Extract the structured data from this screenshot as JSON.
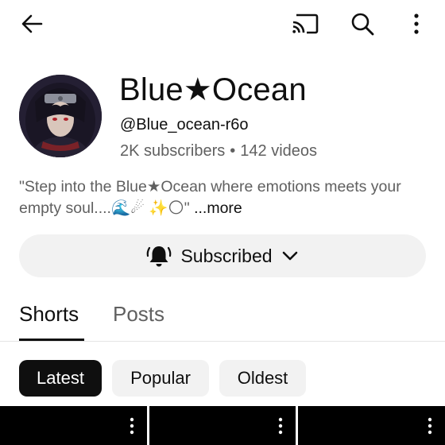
{
  "topbar": {
    "back_icon": "arrow-left-icon",
    "cast_icon": "cast-icon",
    "search_icon": "search-icon",
    "more_icon": "more-vert-icon"
  },
  "channel": {
    "name": "Blue★Ocean",
    "handle": "@Blue_ocean-r6o",
    "subscribers": "2K subscribers",
    "separator": "•",
    "videos": "142 videos",
    "description": "\"Step into the  Blue★Ocean where emotions meets your empty soul....🌊☄ ✨🌕\" ",
    "more_label": "...more"
  },
  "subscribe": {
    "label": "Subscribed",
    "bell_icon": "bell-ringing-icon",
    "chevron_icon": "chevron-down-icon"
  },
  "tabs": [
    "Shorts",
    "Posts"
  ],
  "active_tab": "Shorts",
  "filters": {
    "latest": "Latest",
    "popular": "Popular",
    "oldest": "Oldest",
    "selected": "Latest"
  },
  "colors": {
    "text_primary": "#0f0f0f",
    "text_secondary": "#606060",
    "chip_bg": "#f2f2f2",
    "chip_selected_bg": "#0f0f0f"
  }
}
